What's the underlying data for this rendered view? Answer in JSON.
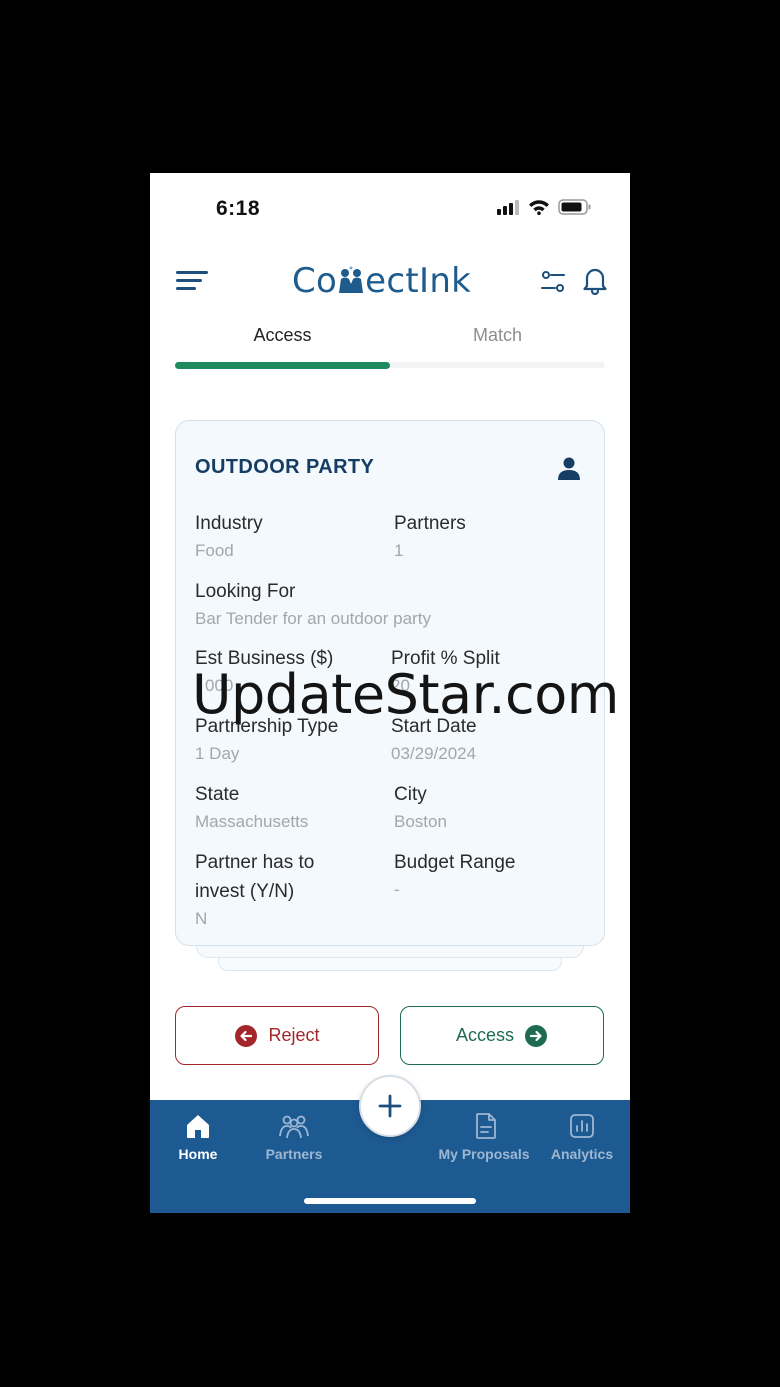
{
  "status_bar": {
    "time": "6:18"
  },
  "header": {
    "logo_text_prefix": "Co",
    "logo_text_suffix": "ectInk"
  },
  "tabs": [
    {
      "label": "Access",
      "active": true
    },
    {
      "label": "Match",
      "active": false
    }
  ],
  "card": {
    "title": "OUTDOOR PARTY",
    "fields": {
      "industry": {
        "label": "Industry",
        "value": "Food"
      },
      "partners": {
        "label": "Partners",
        "value": "1"
      },
      "looking_for": {
        "label": "Looking For",
        "value": "Bar Tender for an outdoor party"
      },
      "est_business": {
        "label": "Est Business ($)",
        "value": "000"
      },
      "profit_split": {
        "label": "Profit % Split",
        "value": "20"
      },
      "partnership_type": {
        "label": "Partnership Type",
        "value": "1 Day"
      },
      "start_date": {
        "label": "Start Date",
        "value": "03/29/2024"
      },
      "state": {
        "label": "State",
        "value": "Massachusetts"
      },
      "city": {
        "label": "City",
        "value": "Boston"
      },
      "partner_invest": {
        "label": "Partner has to invest (Y/N)",
        "value": "N"
      },
      "budget_range": {
        "label": "Budget Range",
        "value": "-"
      }
    }
  },
  "watermark": "UpdateStar.com",
  "actions": {
    "reject": "Reject",
    "access": "Access"
  },
  "bottom_nav": [
    {
      "label": "Home",
      "icon": "home-icon",
      "active": true
    },
    {
      "label": "Partners",
      "icon": "partners-icon",
      "active": false
    },
    {
      "label": "My Proposals",
      "icon": "document-icon",
      "active": false
    },
    {
      "label": "Analytics",
      "icon": "analytics-icon",
      "active": false
    }
  ],
  "colors": {
    "brand_blue": "#1d5a92",
    "accent_green": "#1e8a5e",
    "reject_red": "#a3262a",
    "title_navy": "#163d63"
  }
}
